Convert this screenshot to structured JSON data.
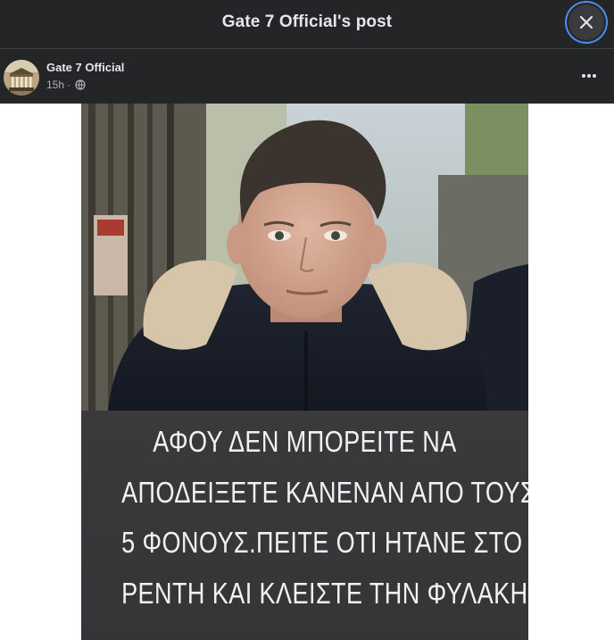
{
  "modal": {
    "title": "Gate 7 Official's post",
    "close_icon": "close-icon"
  },
  "post": {
    "author": "Gate 7 Official",
    "time": "15h",
    "separator": "·",
    "privacy_icon": "globe-icon",
    "more_icon": "more-horizontal-icon",
    "image": {
      "description_icon": "photo",
      "caption_lines": [
        "ΑΦΟΥ ΔΕΝ ΜΠΟΡΕΙΤΕ ΝΑ",
        "ΑΠΟΔΕΙΞΕΤΕ ΚΑΝΕΝΑΝ ΑΠΟ ΤΟΥΣ",
        "5 ΦΟΝΟΥΣ.ΠΕΙΤΕ ΟΤΙ ΗΤΑΝΕ ΣΤΟ",
        "ΡΕΝΤΗ ΚΑΙ ΚΛΕΙΣΤΕ ΤΗΝ ΦΥΛΑΚΗ"
      ]
    }
  },
  "colors": {
    "header_bg": "#242526",
    "text_primary": "#e4e6eb",
    "text_secondary": "#b0b3b8",
    "focus_ring": "#4a8ef1",
    "caption_bg": "#38383a"
  }
}
